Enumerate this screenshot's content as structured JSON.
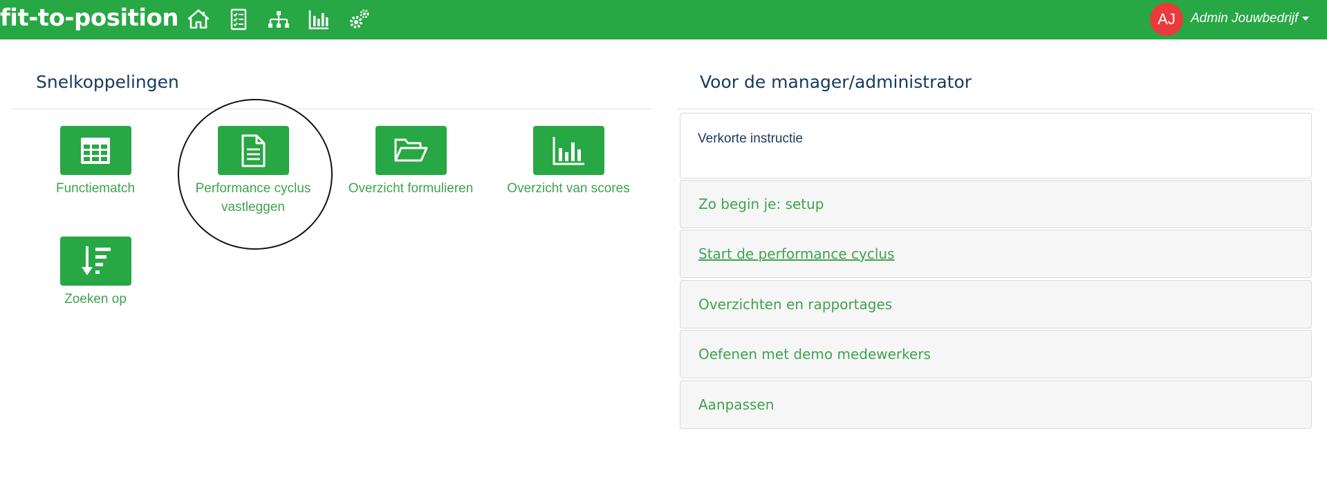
{
  "header": {
    "brand": "fit-to-position",
    "nav_icons": [
      "home-icon",
      "checklist-icon",
      "org-chart-icon",
      "bar-chart-icon",
      "settings-icon"
    ],
    "avatar_initials": "AJ",
    "user_name": "Admin Jouwbedrijf",
    "accent_color": "#28a745",
    "avatar_color": "#e93b3b"
  },
  "shortcuts": {
    "title": "Snelkoppelingen",
    "items": [
      {
        "label": "Functiematch",
        "icon": "table-icon"
      },
      {
        "label": "Performance cyclus vastleggen",
        "icon": "document-icon"
      },
      {
        "label": "Overzicht formulieren",
        "icon": "folder-open-icon"
      },
      {
        "label": "Overzicht van scores",
        "icon": "bar-chart-icon"
      },
      {
        "label": "Zoeken op",
        "icon": "sort-down-icon"
      }
    ]
  },
  "manager": {
    "title": "Voor de manager/administrator",
    "card_text": "Verkorte instructie",
    "accordion": [
      {
        "label": "Zo begin je: setup"
      },
      {
        "label": "Start de performance cyclus"
      },
      {
        "label": "Overzichten en rapportages"
      },
      {
        "label": "Oefenen met demo medewerkers"
      },
      {
        "label": "Aanpassen"
      }
    ]
  }
}
